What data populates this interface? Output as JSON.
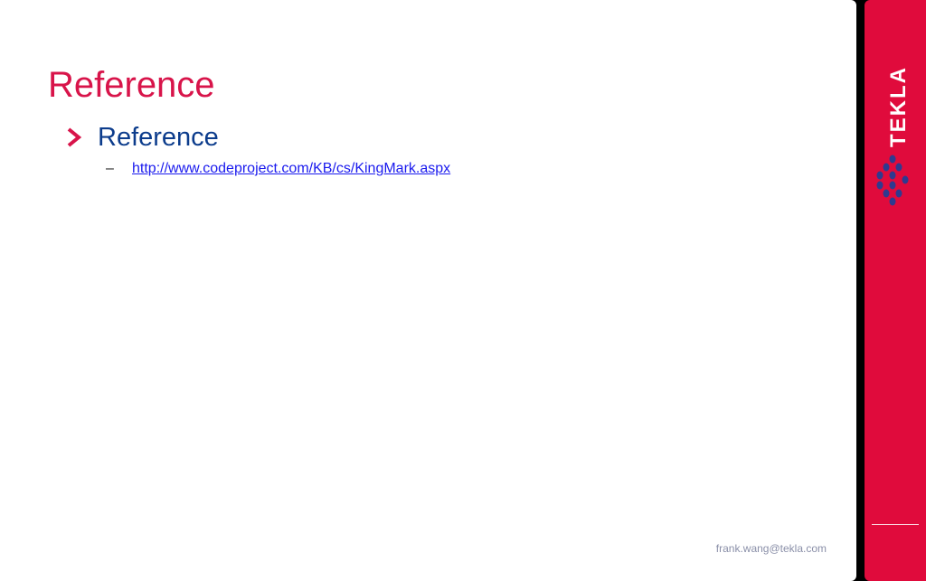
{
  "slide": {
    "title": "Reference",
    "bullets": [
      {
        "label": "Reference",
        "sub_items": [
          {
            "text": "http://www.codeproject.com/KB/cs/KingMark.aspx"
          }
        ]
      }
    ],
    "footer_email": "frank.wang@tekla.com"
  },
  "brand": {
    "name": "TEKLA",
    "logo_icon": "tekla-diamond-dots-icon"
  },
  "colors": {
    "accent_red": "#e00b3c",
    "title_red": "#d8144a",
    "bullet_blue": "#0c3c8c",
    "link_blue": "#1a1aee",
    "footer_gray": "#8a8fa8"
  }
}
